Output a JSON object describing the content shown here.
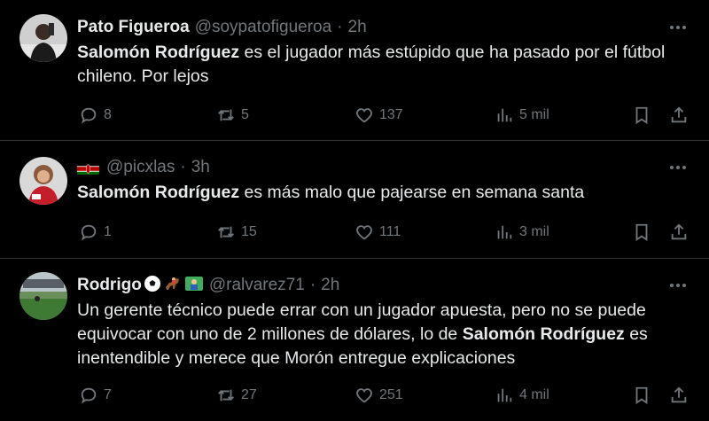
{
  "tweets": [
    {
      "name": "Pato Figueroa",
      "handle": "@soypatofigueroa",
      "separator": "·",
      "time": "2h",
      "text_bold": "Salomón Rodríguez",
      "text_rest": " es el jugador más estúpido que ha pasado por el fútbol chileno. Por lejos",
      "replies": "8",
      "retweets": "5",
      "likes": "137",
      "views": "5 mil"
    },
    {
      "name": "",
      "handle": "@picxlas",
      "separator": "·",
      "time": "3h",
      "text_bold": "Salomón Rodríguez",
      "text_rest": " es más malo que pajearse en semana santa",
      "replies": "1",
      "retweets": "15",
      "likes": "111",
      "views": "3 mil"
    },
    {
      "name": "Rodrigo",
      "handle": "@ralvarez71",
      "separator": "·",
      "time": "2h",
      "text_part1": "Un gerente técnico puede errar con un jugador apuesta, pero no se puede equivocar con uno de 2 millones de dólares, lo de ",
      "text_bold": "Salomón Rodríguez",
      "text_part2": " es inentendible y merece que Morón entregue explicaciones",
      "replies": "7",
      "retweets": "27",
      "likes": "251",
      "views": "4 mil"
    }
  ],
  "more_glyph": "···",
  "colors": {
    "background": "#000000",
    "text": "#e7e9ea",
    "secondary": "#71767b",
    "divider": "#2f3336"
  },
  "icons": [
    "reply-icon",
    "retweet-icon",
    "like-icon",
    "views-icon",
    "bookmark-icon",
    "share-icon",
    "more-icon"
  ]
}
